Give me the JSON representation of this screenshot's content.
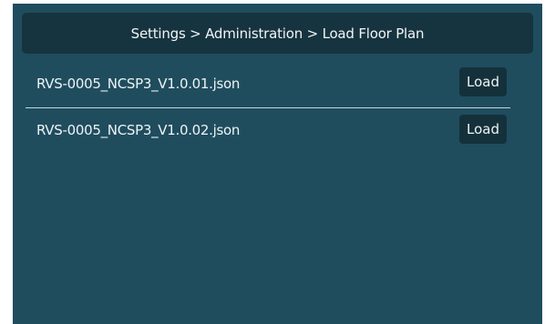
{
  "header": {
    "breadcrumb": "Settings > Administration > Load Floor Plan"
  },
  "files": [
    {
      "name": "RVS-0005_NCSP3_V1.0.01.json",
      "action_label": "Load"
    },
    {
      "name": "RVS-0005_NCSP3_V1.0.02.json",
      "action_label": "Load"
    }
  ],
  "colors": {
    "background": "#1f4d5e",
    "header_bar": "#16343f",
    "button": "#14313b",
    "text": "#eef3f5"
  }
}
